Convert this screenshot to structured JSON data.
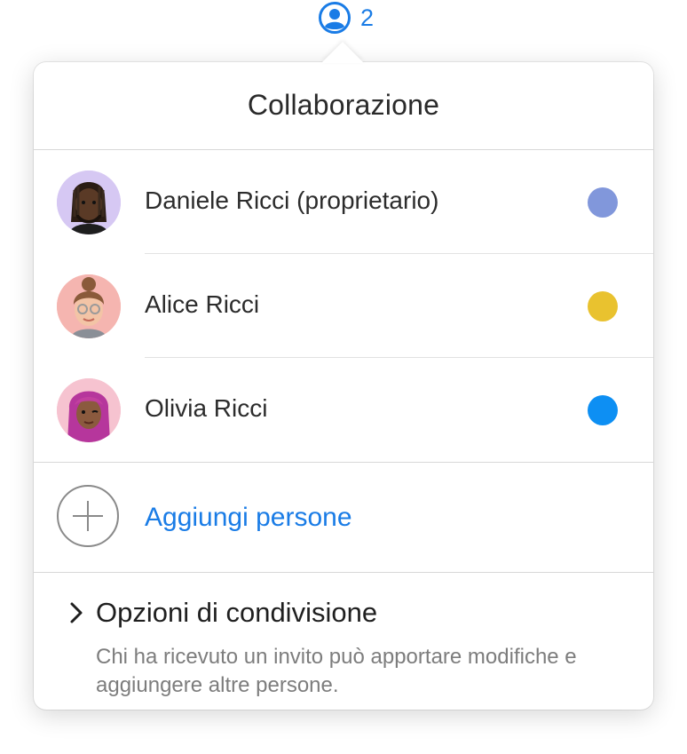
{
  "collaborators_button": {
    "icon": "person-circle-icon",
    "count": "2"
  },
  "popover": {
    "title": "Collaborazione",
    "people": [
      {
        "name": "Daniele Ricci (proprietario)",
        "avatar": "memoji-avatar",
        "color": "#8197db"
      },
      {
        "name": "Alice Ricci",
        "avatar": "memoji-avatar",
        "color": "#e9c22f"
      },
      {
        "name": "Olivia Ricci",
        "avatar": "memoji-avatar",
        "color": "#0d8ff3"
      }
    ],
    "add_people": {
      "icon": "plus-circle-icon",
      "label": "Aggiungi persone"
    },
    "sharing_options": {
      "icon": "chevron-right-icon",
      "title": "Opzioni di condivisione",
      "description": "Chi ha ricevuto un invito può apportare modifiche e aggiungere altre persone."
    }
  },
  "colors": {
    "accent": "#1a7ce6"
  }
}
